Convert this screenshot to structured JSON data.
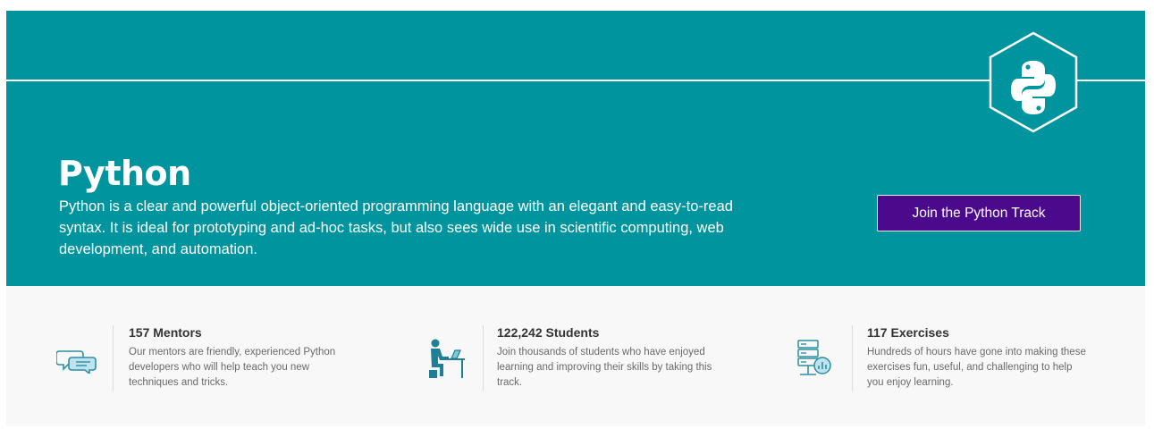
{
  "hero": {
    "title": "Python",
    "description": "Python is a clear and powerful object-oriented programming language with an elegant and easy-to-read syntax. It is ideal for prototyping and ad-hoc tasks, but also sees wide use in scientific computing, web development, and automation.",
    "join_button": "Join the Python Track",
    "logo_icon": "python-logo-icon",
    "background_color": "#00959e",
    "button_color": "#4b0a8c"
  },
  "stats": [
    {
      "heading": "157 Mentors",
      "text": "Our mentors are friendly, experienced Python developers who will help teach you new techniques and tricks.",
      "icon": "chat-bubbles-icon"
    },
    {
      "heading": "122,242 Students",
      "text": "Join thousands of students who have enjoyed learning and improving their skills by taking this track.",
      "icon": "student-at-desk-icon"
    },
    {
      "heading": "117 Exercises",
      "text": "Hundreds of hours have gone into making these exercises fun, useful, and challenging to help you enjoy learning.",
      "icon": "server-chart-icon"
    }
  ]
}
